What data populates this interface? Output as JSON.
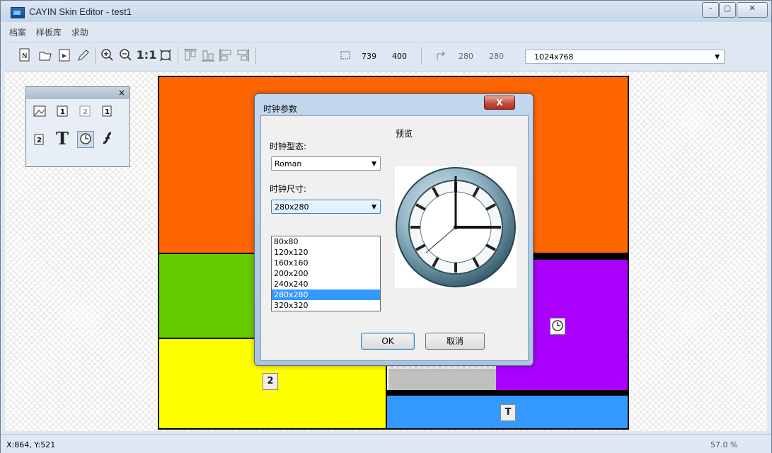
{
  "window": {
    "title": "CAYIN Skin Editor - test1",
    "min_glyph": "–",
    "max_glyph": "▢",
    "close_glyph": "✕"
  },
  "menu": [
    "档案",
    "样板库",
    "求助"
  ],
  "toolbar": {
    "zoom_fit_label": "1:1",
    "width_value": "739",
    "height_value": "400",
    "pos_x_value": "280",
    "pos_y_value": "280",
    "resolution_value": "1024x768"
  },
  "palette": {
    "close_glyph": "×"
  },
  "zones": [
    {
      "name": "zone-orange",
      "color": "#ff6600"
    },
    {
      "name": "zone-green",
      "color": "#66cc00"
    },
    {
      "name": "zone-yellow",
      "color": "#ffff00"
    },
    {
      "name": "zone-gray",
      "color": "#c0c0c0"
    },
    {
      "name": "zone-purple",
      "color": "#aa00ff"
    },
    {
      "name": "zone-blue",
      "color": "#3399ff"
    }
  ],
  "zone_icons": {
    "ticker2": "2",
    "text": "T"
  },
  "dialog": {
    "title": "时钟参数",
    "close_glyph": "X",
    "style_label": "时钟型态:",
    "style_value": "Roman",
    "size_label": "时钟尺寸:",
    "size_value": "280x280",
    "size_options": [
      "80x80",
      "120x120",
      "160x160",
      "200x200",
      "240x240",
      "280x280",
      "320x320"
    ],
    "selected_size": "280x280",
    "preview_label": "预览",
    "ok_label": "OK",
    "cancel_label": "取消"
  },
  "status": {
    "coords": "X:864, Y:521",
    "zoom": "57.0 %"
  }
}
